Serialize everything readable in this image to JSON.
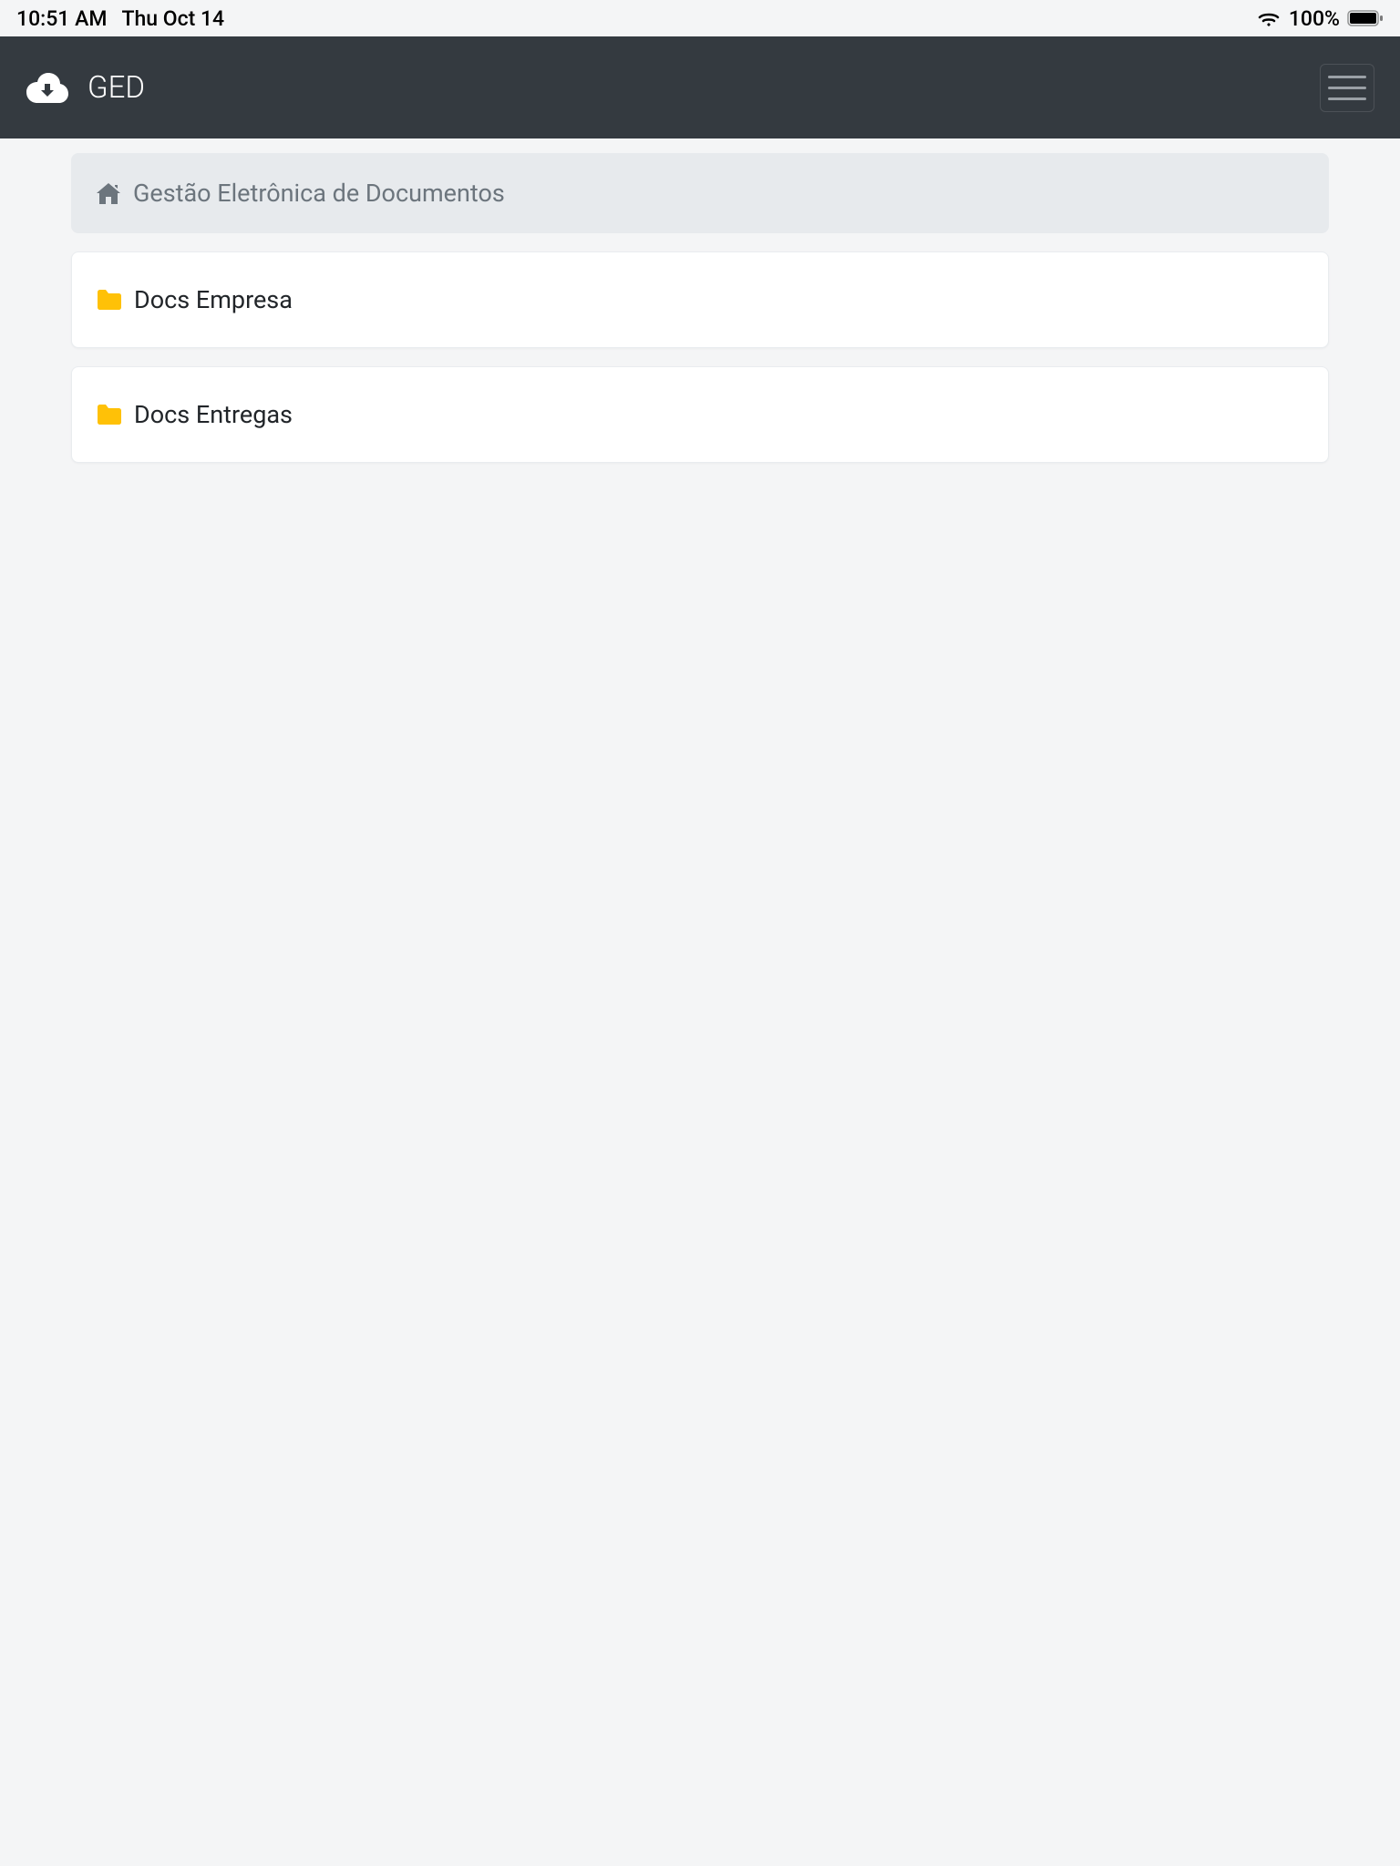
{
  "status": {
    "time": "10:51 AM",
    "date": "Thu Oct 14",
    "battery": "100%"
  },
  "navbar": {
    "title": "GED"
  },
  "breadcrumb": {
    "title": "Gestão Eletrônica de Documentos"
  },
  "folders": [
    {
      "name": "Docs Empresa"
    },
    {
      "name": "Docs Entregas"
    }
  ]
}
